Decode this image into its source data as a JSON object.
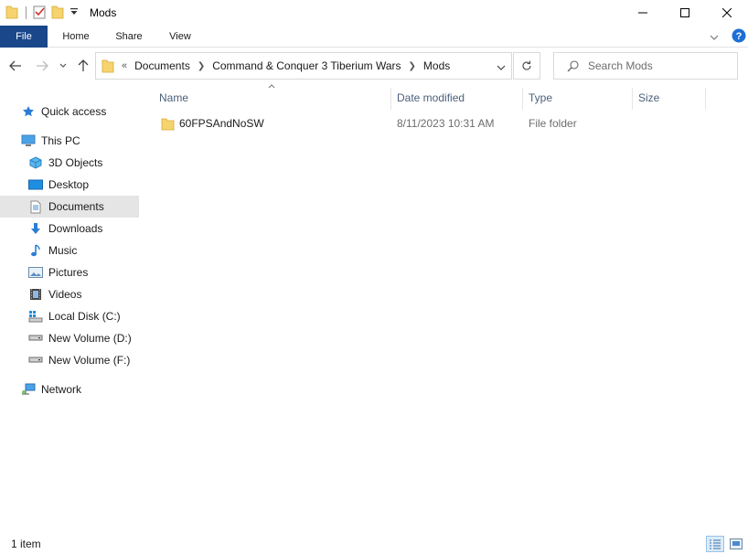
{
  "window": {
    "title": "Mods"
  },
  "ribbon": {
    "tabs": [
      "File",
      "Home",
      "Share",
      "View"
    ],
    "file_color": "#19478a"
  },
  "address": {
    "overflow": "«",
    "crumbs": [
      "Documents",
      "Command & Conquer 3 Tiberium Wars",
      "Mods"
    ]
  },
  "search": {
    "placeholder": "Search Mods"
  },
  "sidebar": {
    "quick_access": "Quick access",
    "this_pc": "This PC",
    "items": [
      "3D Objects",
      "Desktop",
      "Documents",
      "Downloads",
      "Music",
      "Pictures",
      "Videos",
      "Local Disk (C:)",
      "New Volume (D:)",
      "New Volume (F:)"
    ],
    "selected": "Documents",
    "network": "Network"
  },
  "columns": {
    "name": "Name",
    "date": "Date modified",
    "type": "Type",
    "size": "Size"
  },
  "files": [
    {
      "name": "60FPSAndNoSW",
      "date": "8/11/2023 10:31 AM",
      "type": "File folder",
      "size": ""
    }
  ],
  "status": {
    "count": "1 item"
  }
}
